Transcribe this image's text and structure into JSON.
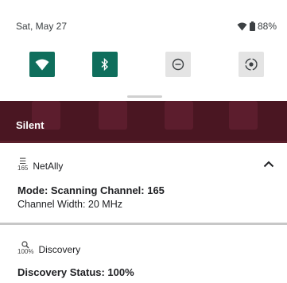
{
  "status_bar": {
    "date": "Sat, May 27",
    "battery": "88%"
  },
  "quick_tiles": [
    {
      "name": "wifi",
      "state": "on"
    },
    {
      "name": "bluetooth",
      "state": "on"
    },
    {
      "name": "do-not-disturb",
      "state": "off"
    },
    {
      "name": "auto-rotate",
      "state": "off"
    }
  ],
  "section": {
    "label": "Silent"
  },
  "notifications": [
    {
      "icon_label": "165",
      "app": "NetAlly",
      "title": "Mode: Scanning Channel: 165",
      "text": "Channel Width:  20 MHz"
    },
    {
      "icon_label": "100%",
      "app": "Discovery",
      "title": "Discovery Status: 100%"
    }
  ],
  "colors": {
    "accent": "#0f6e5c",
    "backdrop": "#5a1f2b"
  }
}
